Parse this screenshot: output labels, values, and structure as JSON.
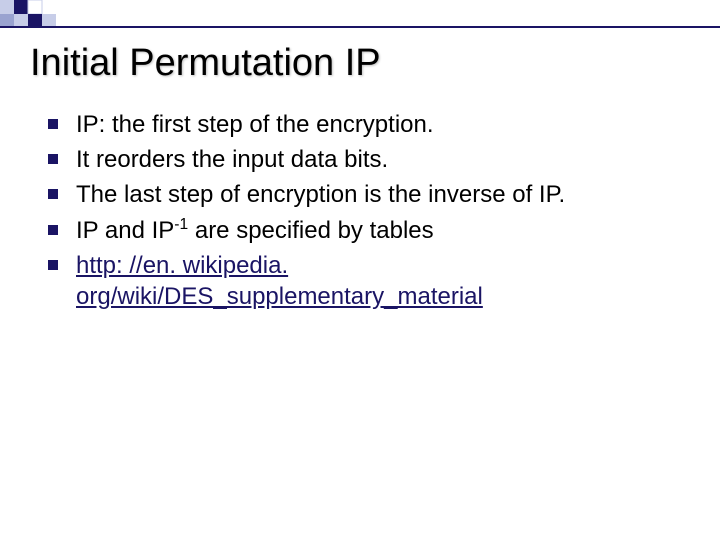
{
  "slide": {
    "title": "Initial Permutation IP",
    "items": [
      {
        "text": "IP: the first step of the encryption."
      },
      {
        "text": "It reorders the input data bits."
      },
      {
        "text": "The last step of encryption is the inverse of IP."
      },
      {
        "prefix": "IP and IP",
        "sup": "-1",
        "suffix": " are specified by tables"
      },
      {
        "link": "http: //en. wikipedia. org/wiki/DES_supplementary_material"
      }
    ]
  },
  "theme": {
    "accent": "#1a1464",
    "light_square": "#c7cde8",
    "mid_square": "#9aa3d0"
  }
}
